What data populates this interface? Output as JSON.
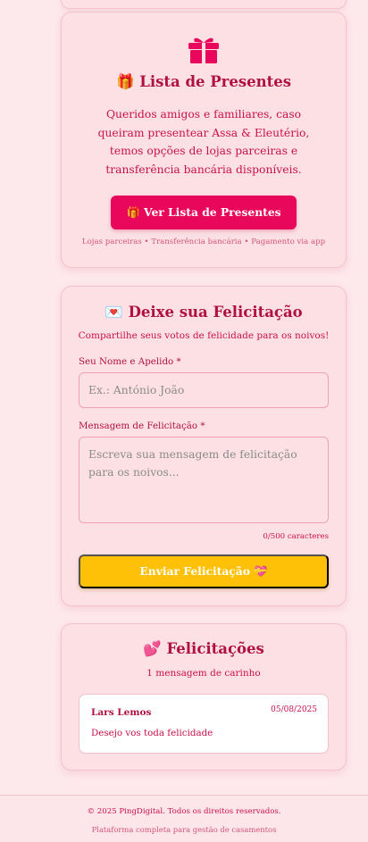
{
  "gift_section": {
    "icon": "gift-icon",
    "title": "🎁 Lista de Presentes",
    "description": "Queridos amigos e familiares, caso queiram presentear Assa & Eleutério, temos opções de lojas parceiras e transferência bancária disponíveis.",
    "button_label": "🎁 Ver Lista de Presentes",
    "footer_note": "Lojas parceiras • Transferência bancária • Pagamento via app",
    "accent_color": "#e8075a"
  },
  "form_section": {
    "title": "💌 Deixe sua Felicitação",
    "subtitle": "Compartilhe seus votos de felicidade para os noivos!",
    "name_label": "Seu Nome e Apelido *",
    "name_placeholder": "Ex.: António João",
    "message_label": "Mensagem de Felicitação *",
    "message_placeholder": "Escreva sua mensagem de felicitação para os noivos...",
    "char_counter": "0/500 caracteres",
    "submit_label": "Enviar Felicitação 💝",
    "submit_color": "#ffc107"
  },
  "wishes_section": {
    "title": "💕 Felicitações",
    "count_text": "1 mensagem de carinho",
    "items": [
      {
        "name": "Lars Lemos",
        "date": "05/08/2025",
        "message": "Desejo vos toda felicidade"
      }
    ]
  },
  "footer": {
    "copyright": "© 2025 PingDigital. Todos os direitos reservados.",
    "tagline": "Plataforma completa para gestão de casamentos"
  }
}
